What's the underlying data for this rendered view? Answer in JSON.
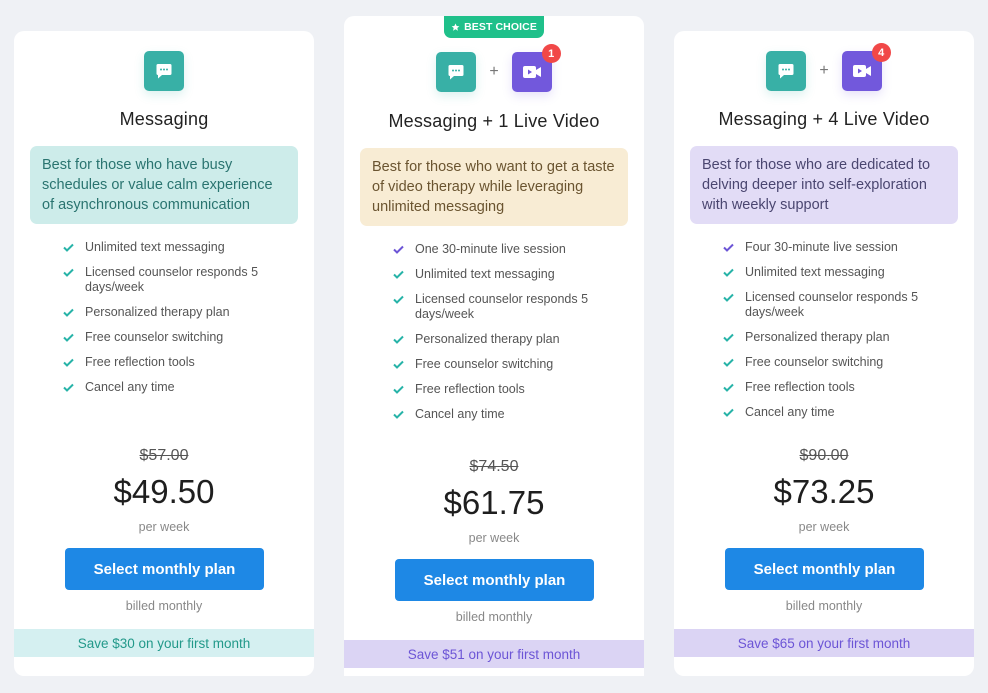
{
  "colors": {
    "page_bg": "#eff1f5",
    "messaging_icon": "#38b0a6",
    "video_icon": "#7258dc",
    "count_badge": "#f14848",
    "best_choice_badge": "#1fc08a",
    "button": "#1e88e5",
    "check_teal": "#27b3a8",
    "check_purple": "#6c55d6"
  },
  "plans": [
    {
      "title": "Messaging",
      "icons": [
        "message-icon"
      ],
      "description": "Best for those who have busy schedules or value calm experience of asynchronous communication",
      "features": [
        {
          "text": "Unlimited text messaging",
          "check": "teal"
        },
        {
          "text": "Licensed counselor responds 5 days/week",
          "check": "teal"
        },
        {
          "text": "Personalized therapy plan",
          "check": "teal"
        },
        {
          "text": "Free counselor switching",
          "check": "teal"
        },
        {
          "text": "Free reflection tools",
          "check": "teal"
        },
        {
          "text": "Cancel any time",
          "check": "teal"
        }
      ],
      "old_price": "$57.00",
      "price": "$49.50",
      "period": "per week",
      "button_label": "Select monthly plan",
      "billing": "billed monthly",
      "savings": "Save $30 on your first month"
    },
    {
      "badge": "BEST CHOICE",
      "title": "Messaging + 1 Live Video",
      "icons": [
        "message-icon",
        "video-icon"
      ],
      "plus": "+",
      "video_count": "1",
      "description": "Best for those who want to get a taste of video therapy while leveraging unlimited messaging",
      "features": [
        {
          "text": "One 30-minute live session",
          "check": "purple"
        },
        {
          "text": "Unlimited text messaging",
          "check": "teal"
        },
        {
          "text": "Licensed counselor responds 5 days/week",
          "check": "teal"
        },
        {
          "text": "Personalized therapy plan",
          "check": "teal"
        },
        {
          "text": "Free counselor switching",
          "check": "teal"
        },
        {
          "text": "Free reflection tools",
          "check": "teal"
        },
        {
          "text": "Cancel any time",
          "check": "teal"
        }
      ],
      "old_price": "$74.50",
      "price": "$61.75",
      "period": "per week",
      "button_label": "Select monthly plan",
      "billing": "billed monthly",
      "savings": "Save $51 on your first month"
    },
    {
      "title": "Messaging + 4 Live Video",
      "icons": [
        "message-icon",
        "video-icon"
      ],
      "plus": "+",
      "video_count": "4",
      "description": "Best for those who are dedicated to delving deeper into self-exploration with weekly support",
      "features": [
        {
          "text": "Four 30-minute live session",
          "check": "purple"
        },
        {
          "text": "Unlimited text messaging",
          "check": "teal"
        },
        {
          "text": "Licensed counselor responds 5 days/week",
          "check": "teal"
        },
        {
          "text": "Personalized therapy plan",
          "check": "teal"
        },
        {
          "text": "Free counselor switching",
          "check": "teal"
        },
        {
          "text": "Free reflection tools",
          "check": "teal"
        },
        {
          "text": "Cancel any time",
          "check": "teal"
        }
      ],
      "old_price": "$90.00",
      "price": "$73.25",
      "period": "per week",
      "button_label": "Select monthly plan",
      "billing": "billed monthly",
      "savings": "Save $65 on your first month"
    }
  ]
}
